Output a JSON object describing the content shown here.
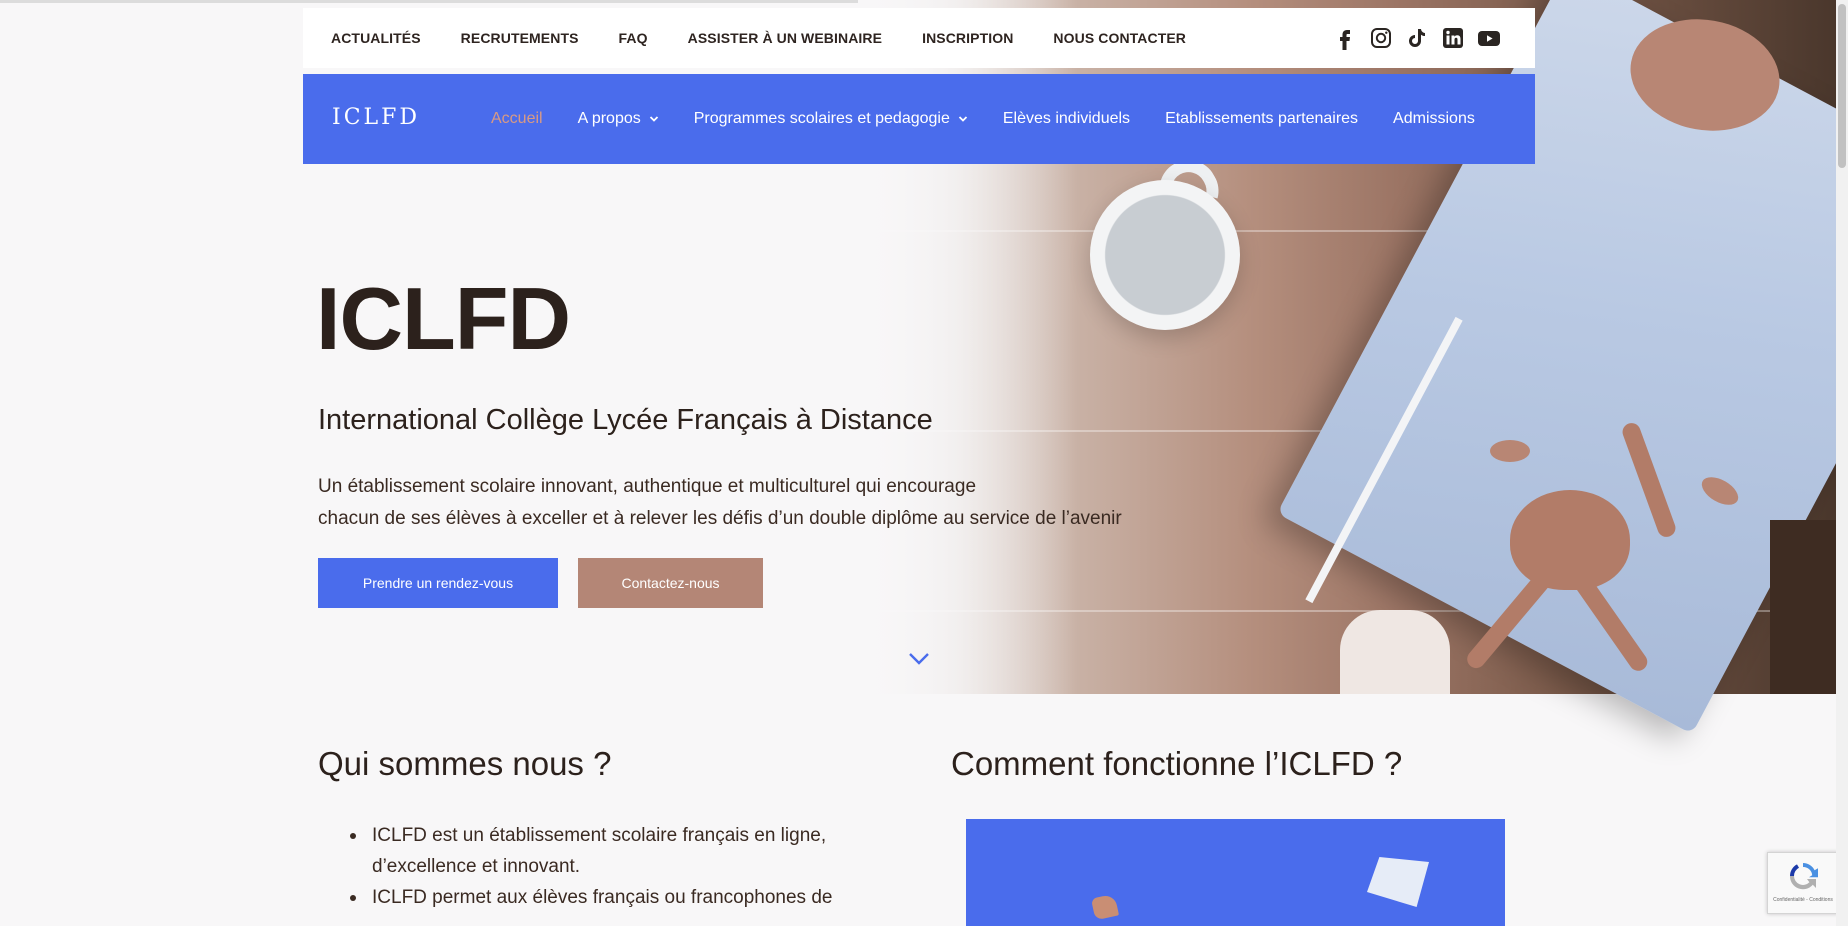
{
  "colors": {
    "primary_blue": "#4a6cec",
    "accent_brown": "#b48676",
    "active_nav": "#d89a84",
    "text_dark": "#2c211c"
  },
  "topbar": {
    "links": [
      "ACTUALITÉS",
      "RECRUTEMENTS",
      "FAQ",
      "ASSISTER À UN WEBINAIRE",
      "INSCRIPTION",
      "NOUS CONTACTER"
    ],
    "social_icons": [
      "facebook-icon",
      "instagram-icon",
      "tiktok-icon",
      "linkedin-icon",
      "youtube-icon"
    ]
  },
  "nav": {
    "brand": "ICLFD",
    "items": [
      {
        "label": "Accueil",
        "active": true,
        "dropdown": false
      },
      {
        "label": "A propos",
        "active": false,
        "dropdown": true
      },
      {
        "label": "Programmes scolaires et pedagogie",
        "active": false,
        "dropdown": true
      },
      {
        "label": "Elèves individuels",
        "active": false,
        "dropdown": false
      },
      {
        "label": "Etablissements partenaires",
        "active": false,
        "dropdown": false
      },
      {
        "label": "Admissions",
        "active": false,
        "dropdown": false
      }
    ]
  },
  "hero": {
    "title": "ICLFD",
    "subtitle": "International Collège Lycée Français à Distance",
    "description_line1": "Un établissement scolaire innovant, authentique et multiculturel qui encourage",
    "description_line2": "chacun de ses élèves à exceller et à relever les défis d’un double diplôme au service de l’avenir",
    "primary_button": "Prendre un rendez-vous",
    "secondary_button": "Contactez-nous"
  },
  "about": {
    "heading": "Qui sommes nous ?",
    "bullets": [
      "ICLFD est un établissement scolaire français en ligne, d’excellence et innovant.",
      "ICLFD permet aux élèves français ou francophones de"
    ]
  },
  "how": {
    "heading": "Comment fonctionne l’ICLFD ?"
  },
  "recaptcha": {
    "text": "Confidentialité - Conditions"
  }
}
